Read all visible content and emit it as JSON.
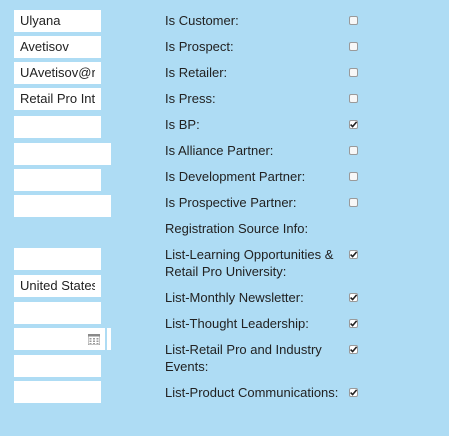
{
  "left_fields": {
    "first_name": {
      "value": "Ulyana"
    },
    "last_name": {
      "value": "Avetisov"
    },
    "email": {
      "value": "UAvetisov@retailpro.com"
    },
    "company": {
      "value": "Retail Pro International"
    },
    "field_5": {
      "value": ""
    },
    "field_6": {
      "value": ""
    },
    "field_7": {
      "value": ""
    },
    "field_8": {
      "value": ""
    },
    "field_9": {
      "value": ""
    },
    "country": {
      "value": "United States"
    },
    "field_11": {
      "value": ""
    },
    "date_field": {
      "value": "",
      "icon": "calendar-icon"
    },
    "field_13": {
      "value": ""
    },
    "field_14": {
      "value": ""
    }
  },
  "options": [
    {
      "label": "Is Customer:",
      "checked": false
    },
    {
      "label": "Is Prospect:",
      "checked": false
    },
    {
      "label": "Is Retailer:",
      "checked": false
    },
    {
      "label": "Is Press:",
      "checked": false
    },
    {
      "label": "Is BP:",
      "checked": true
    },
    {
      "label": "Is Alliance Partner:",
      "checked": false
    },
    {
      "label": "Is Development Partner:",
      "checked": false
    },
    {
      "label": "Is Prospective Partner:",
      "checked": false
    },
    {
      "label": "Registration Source Info:"
    },
    {
      "label": "List-Learning Opportunities & Retail Pro University:",
      "checked": true
    },
    {
      "label": "List-Monthly Newsletter:",
      "checked": true
    },
    {
      "label": "List-Thought Leadership:",
      "checked": true
    },
    {
      "label": "List-Retail Pro and Industry Events:",
      "checked": true
    },
    {
      "label": "List-Product Communications:",
      "checked": true
    }
  ],
  "colors": {
    "background": "#aedcf4",
    "field": "#ffffff",
    "text": "#222222"
  }
}
